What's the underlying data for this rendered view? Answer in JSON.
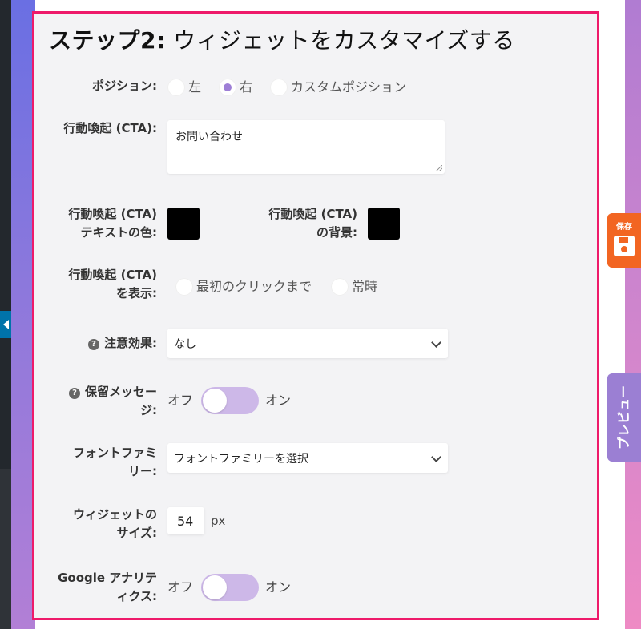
{
  "title": {
    "bold": "ステップ2:",
    "rest": "ウィジェットをカスタマイズする"
  },
  "position": {
    "label": "ポジション:",
    "options": [
      "左",
      "右",
      "カスタムポジション"
    ],
    "selected": "右"
  },
  "cta": {
    "label": "行動喚起 (CTA):",
    "value": "お問い合わせ"
  },
  "cta_text_color": {
    "label_line1": "行動喚起 (CTA)",
    "label_line2": "テキストの色:",
    "color": "#000000"
  },
  "cta_bg_color": {
    "label_line1": "行動喚起 (CTA)",
    "label_line2": "の背景:",
    "color": "#000000"
  },
  "cta_display": {
    "label_line1": "行動喚起 (CTA)",
    "label_line2": "を表示:",
    "options": [
      "最初のクリックまで",
      "常時"
    ]
  },
  "attention_effect": {
    "label": "注意効果:",
    "value": "なし"
  },
  "pending_message": {
    "label_line1": "保留メッセー",
    "label_line2": "ジ:",
    "off": "オフ",
    "on": "オン",
    "enabled": false
  },
  "font_family": {
    "label_line1": "フォントファミ",
    "label_line2": "リー:",
    "value": "フォントファミリーを選択"
  },
  "widget_size": {
    "label_line1": "ウィジェットの",
    "label_line2": "サイズ:",
    "value": "54",
    "unit": "px"
  },
  "google_analytics": {
    "label_line1": "Google アナリテ",
    "label_line2": "ィクス:",
    "off": "オフ",
    "on": "オン",
    "enabled": false
  },
  "save_tab": {
    "label": "保存"
  },
  "preview_tab": {
    "label": "プレビュー"
  },
  "colors": {
    "accent_border": "#ee1a6a",
    "toggle_track": "#cdb8e8",
    "radio_checked": "#9e7fd6",
    "save": "#f26522",
    "preview": "#9b7fd3"
  },
  "icons": {
    "help": "question-circle-icon",
    "save": "floppy-disk-icon",
    "select": "chevron-down-icon",
    "admin_collapse": "triangle-left-icon"
  }
}
